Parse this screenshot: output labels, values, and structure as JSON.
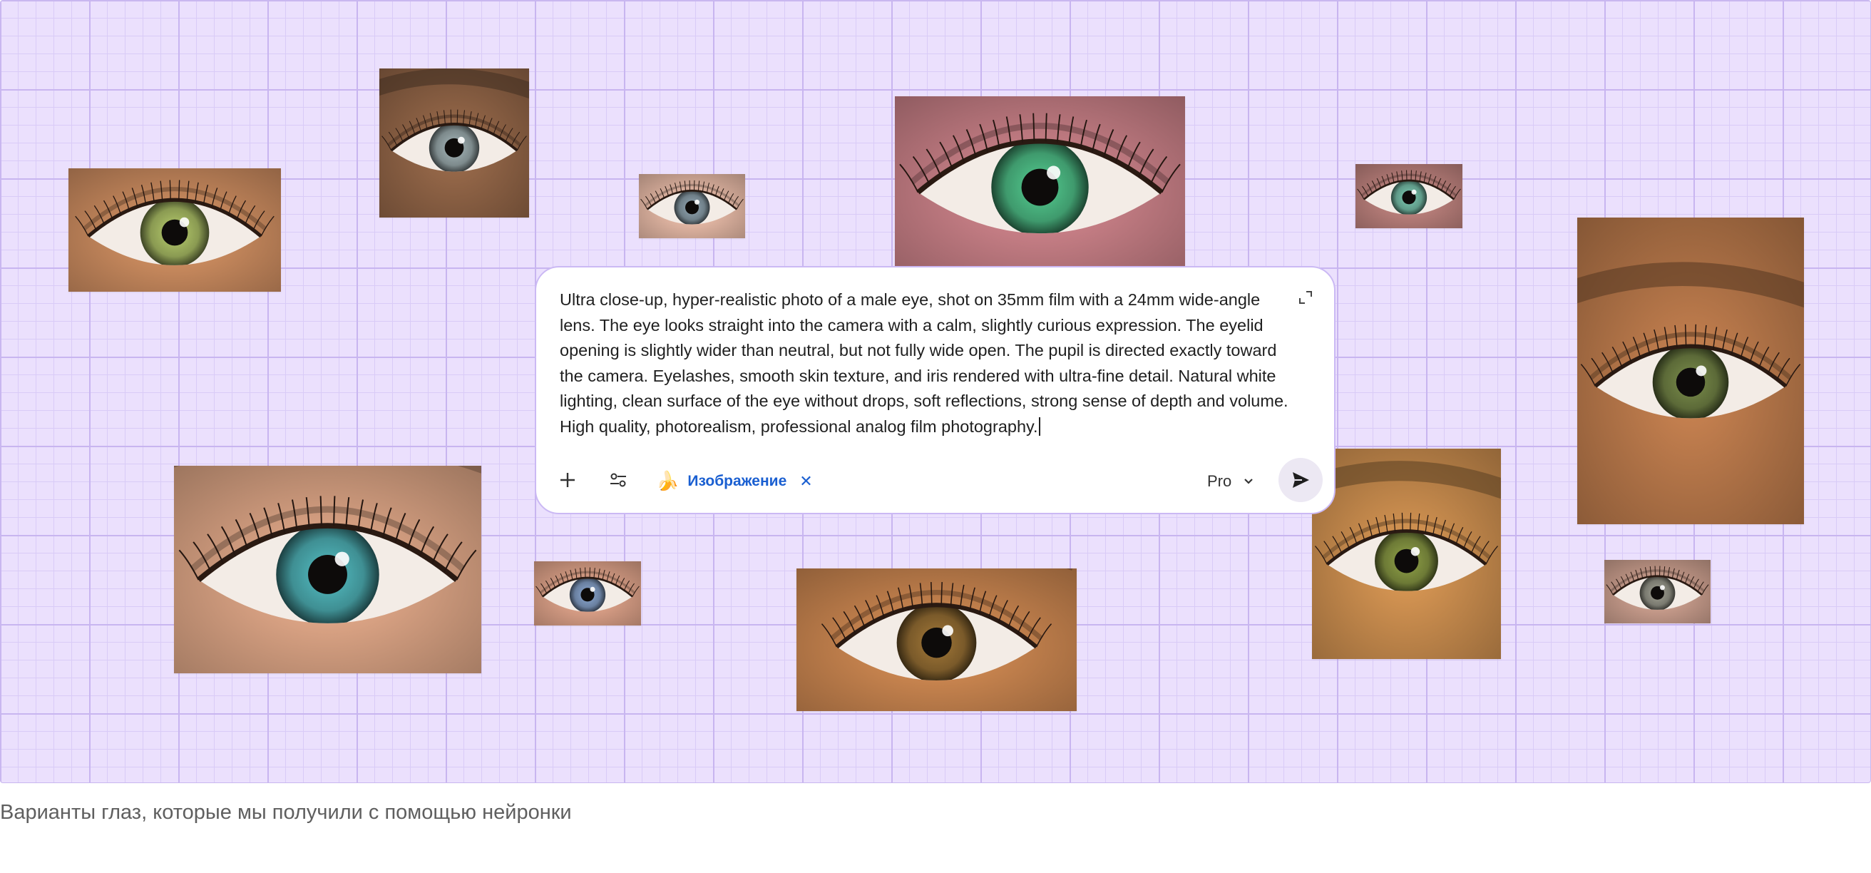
{
  "prompt": {
    "text": "Ultra close-up, hyper-realistic photo of a male eye, shot on 35mm film with a 24mm wide-angle lens. The eye looks straight into the camera with a calm, slightly curious expression. The eyelid opening is slightly wider than neutral, but not fully wide open. The pupil is directed exactly toward the camera. Eyelashes, smooth skin texture, and iris rendered with ultra-fine detail. Natural white lighting, clean surface of the eye without drops, soft reflections, strong sense of depth and volume. High quality, photorealism, professional analog film photography.",
    "chip_label": "Изображение",
    "chip_icon": "banana-icon",
    "model": "Pro"
  },
  "eyes": [
    {
      "iris": "#8a9a52",
      "skin": "#c98a5e"
    },
    {
      "iris": "#7d8a8c",
      "skin": "#8f6346"
    },
    {
      "iris": "#6f7f88",
      "skin": "#e2b6a3"
    },
    {
      "iris": "#3f9a6d",
      "skin": "#c77f86"
    },
    {
      "iris": "#5f9a88",
      "skin": "#b97f7a"
    },
    {
      "iris": "#5c6a38",
      "skin": "#b8784a"
    },
    {
      "iris": "#3f8f93",
      "skin": "#d9a283"
    },
    {
      "iris": "#6a80a0",
      "skin": "#d89e86"
    },
    {
      "iris": "#7a5a2a",
      "skin": "#c8844f"
    },
    {
      "iris": "#6d7a36",
      "skin": "#c98c4e"
    },
    {
      "iris": "#7a7a70",
      "skin": "#c79b8b"
    }
  ],
  "colors": {
    "canvas_bg": "#ebe0fd",
    "grid_line": "#c8b5f0",
    "chip_text": "#1a5fd1"
  },
  "caption": "Варианты глаз, которые мы получили с помощью нейронки"
}
